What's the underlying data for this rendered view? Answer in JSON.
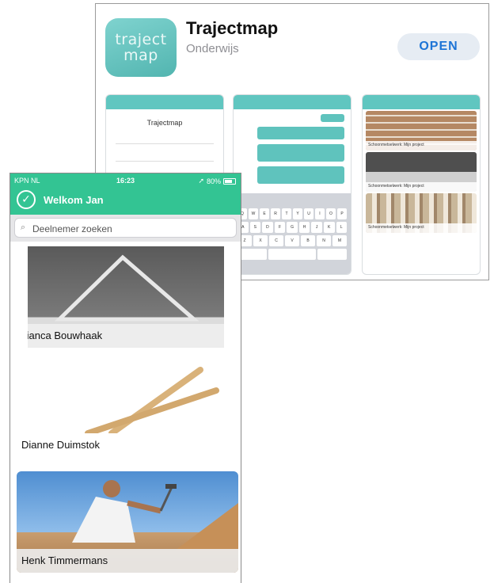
{
  "store": {
    "icon_line1": "traject",
    "icon_line2": "map",
    "title": "Trajectmap",
    "category": "Onderwijs",
    "open_label": "OPEN",
    "screenshot1_title": "Trajectmap",
    "screenshot3_caption": "Schoonmetselwerk: Mijn project"
  },
  "phone": {
    "status": {
      "carrier": "KPN NL",
      "time": "16:23",
      "battery": "80%"
    },
    "header_title": "Welkom Jan",
    "search_placeholder": "Deelnemer zoeken",
    "participants": [
      {
        "name": "Bianca Bouwhaak"
      },
      {
        "name": "Dianne Duimstok"
      },
      {
        "name": "Henk Timmermans"
      }
    ]
  },
  "colors": {
    "teal": "#5fc3bd",
    "green": "#33c493",
    "open_text": "#1d74d6"
  }
}
